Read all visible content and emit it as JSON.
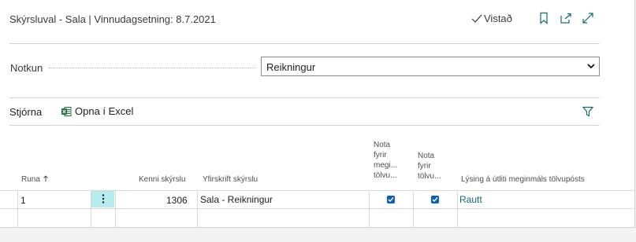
{
  "header": {
    "title": "Skýrsluval - Sala | Vinnudagsetning: 8.7.2021",
    "saved_label": "Vistað",
    "icons": [
      "checkmark-icon",
      "bookmark-icon",
      "share-icon",
      "expand-icon"
    ]
  },
  "form": {
    "usage_label": "Notkun",
    "usage_value": "Reikningur"
  },
  "actions": {
    "tab_label": "Stjórna",
    "excel_label": "Opna í Excel"
  },
  "table": {
    "columns": {
      "sequence": "Runa",
      "report_id": "Kenni skýrslu",
      "report_caption": "Yfirskrift skýrslu",
      "default_email_line1": "Nota",
      "default_email_line2": "fyrir",
      "default_email_line3": "megi...",
      "default_email_line4": "tölvu...",
      "use_email_line1": "Nota",
      "use_email_line2": "fyrir",
      "use_email_line3": "tölvu...",
      "email_body_desc": "Lýsing á útliti meginmáls tölvupósts"
    },
    "rows": [
      {
        "sequence": "1",
        "report_id": "1306",
        "report_caption": "Sala - Reikningur",
        "default_email_checked": true,
        "use_email_checked": true,
        "email_body_desc": "Rautt"
      }
    ]
  },
  "colors": {
    "accent": "#106e6e",
    "checkbox": "#0a5fbf",
    "selected_cell": "#b6ecef"
  }
}
